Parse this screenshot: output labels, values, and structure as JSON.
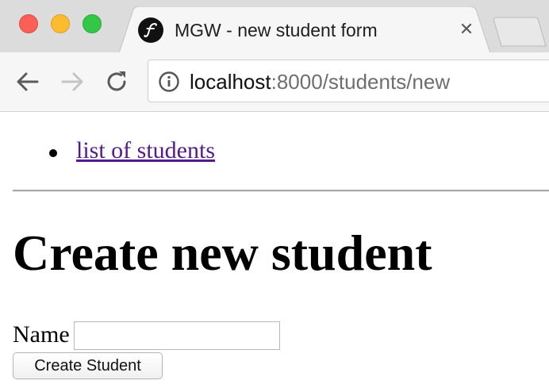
{
  "browser": {
    "tab": {
      "title": "MGW - new student form",
      "favicon": "symfony-icon",
      "close_icon": "close-icon",
      "close_glyph": "✕"
    },
    "toolbar": {
      "back_icon": "back-arrow-icon",
      "forward_icon": "forward-arrow-icon",
      "reload_icon": "reload-icon",
      "info_icon": "info-icon",
      "url_host": "localhost",
      "url_rest": ":8000/students/new"
    },
    "window_controls": [
      "close",
      "minimize",
      "maximize"
    ],
    "colors": {
      "close": "#fc5f57",
      "minimize": "#fdbc2e",
      "maximize": "#33c748"
    }
  },
  "page": {
    "nav": {
      "items": [
        {
          "label": "list of students"
        }
      ]
    },
    "heading": "Create new student",
    "form": {
      "name_label": "Name",
      "name_value": "",
      "submit_label": "Create Student"
    },
    "colors": {
      "visited_link": "#551a8b"
    }
  }
}
